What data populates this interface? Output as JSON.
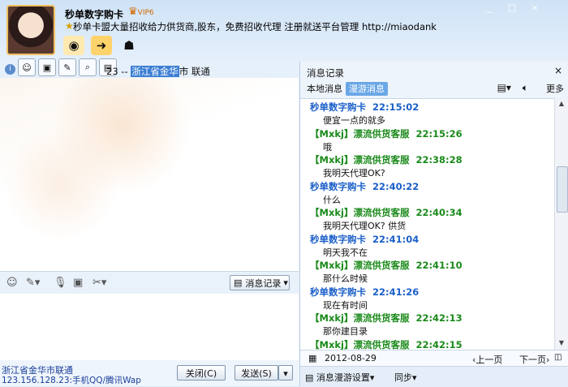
{
  "header": {
    "contact_name": "秒单数字购卡",
    "badge": "VIP6",
    "signature": "秒单卡盟大量招收给力供货商,股东，免费招收代理 注册就送平台管理   http://miaodank"
  },
  "window_controls": [
    "_",
    "□",
    "×"
  ],
  "location": {
    "prefix": "23 -- ",
    "highlighted": "浙江省金华",
    "suffix": "市 联通"
  },
  "input_toolbar": {
    "history_button": "消息记录"
  },
  "footer": {
    "location": "浙江省金华市联通",
    "ip_info": "123.156.128.23:手机QQ/腾讯Wap",
    "close_button": "关闭(C)",
    "send_button": "发送(S)"
  },
  "history": {
    "title": "消息记录",
    "tabs": [
      {
        "label": "本地消息"
      },
      {
        "label": "漫游消息"
      }
    ],
    "more": "更多",
    "messages": [
      {
        "sender": "秒单数字购卡",
        "time": "22:15:02",
        "text": "便宜一点的就多",
        "kind": "me"
      },
      {
        "sender": "【Mxkj】漂流供货客服",
        "time": "22:15:26",
        "text": "哦",
        "kind": "them"
      },
      {
        "sender": "【Mxkj】漂流供货客服",
        "time": "22:38:28",
        "text": "我明天代理OK?",
        "kind": "them"
      },
      {
        "sender": "秒单数字购卡",
        "time": "22:40:22",
        "text": "什么",
        "kind": "me"
      },
      {
        "sender": "【Mxkj】漂流供货客服",
        "time": "22:40:34",
        "text": "我明天代理OK? 供货",
        "kind": "them"
      },
      {
        "sender": "秒单数字购卡",
        "time": "22:41:04",
        "text": "明天我不在",
        "kind": "me"
      },
      {
        "sender": "【Mxkj】漂流供货客服",
        "time": "22:41:10",
        "text": "那什么时候",
        "kind": "them"
      },
      {
        "sender": "秒单数字购卡",
        "time": "22:41:26",
        "text": "现在有时间",
        "kind": "me"
      },
      {
        "sender": "【Mxkj】漂流供货客服",
        "time": "22:42:13",
        "text": "那你建目录",
        "kind": "them"
      },
      {
        "sender": "【Mxkj】漂流供货客服",
        "time": "22:42:15",
        "text": "",
        "kind": "them"
      }
    ],
    "date": "2012-08-29",
    "prev_page": "上一页",
    "next_page": "下一页",
    "settings": "消息漫游设置",
    "sync": "同步"
  },
  "colors": {
    "me_sender": "#1b5fc9",
    "them_sender": "#1a8a1a",
    "highlight": "#3c7fd4"
  }
}
